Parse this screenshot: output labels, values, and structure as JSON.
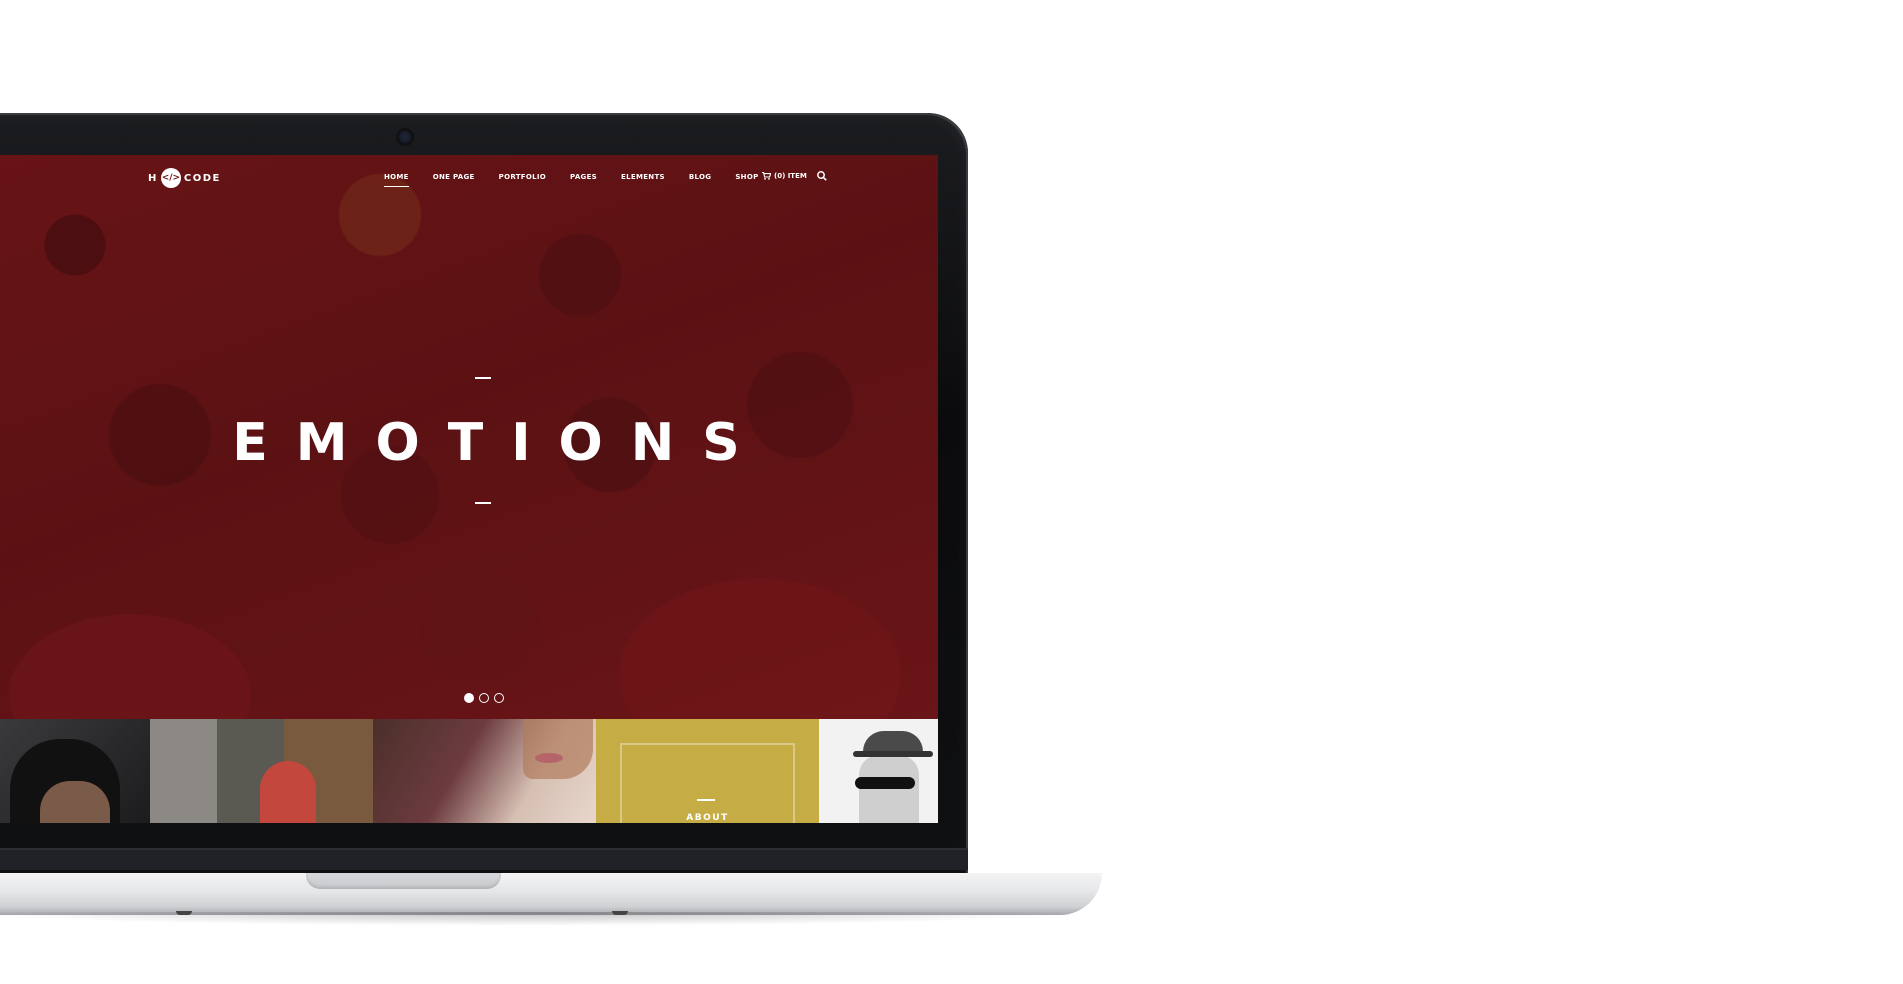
{
  "site": {
    "logo": {
      "left_text": "H",
      "mark": "</>",
      "right_text": "CODE"
    },
    "menu": [
      {
        "label": "HOME",
        "active": true
      },
      {
        "label": "ONE PAGE",
        "active": false
      },
      {
        "label": "PORTFOLIO",
        "active": false
      },
      {
        "label": "PAGES",
        "active": false
      },
      {
        "label": "ELEMENTS",
        "active": false
      },
      {
        "label": "BLOG",
        "active": false
      },
      {
        "label": "SHOP",
        "active": false
      }
    ],
    "cart_label": "(0) ITEM",
    "cart_icon": "cart-icon",
    "search_icon": "search-icon"
  },
  "hero": {
    "title": "EMOTIONS",
    "slide_count": 3,
    "active_slide": 1
  },
  "tiles": {
    "about_label": "ABOUT"
  },
  "colors": {
    "hero_red": "#6b1517",
    "tile_gold": "#c6ac45"
  }
}
